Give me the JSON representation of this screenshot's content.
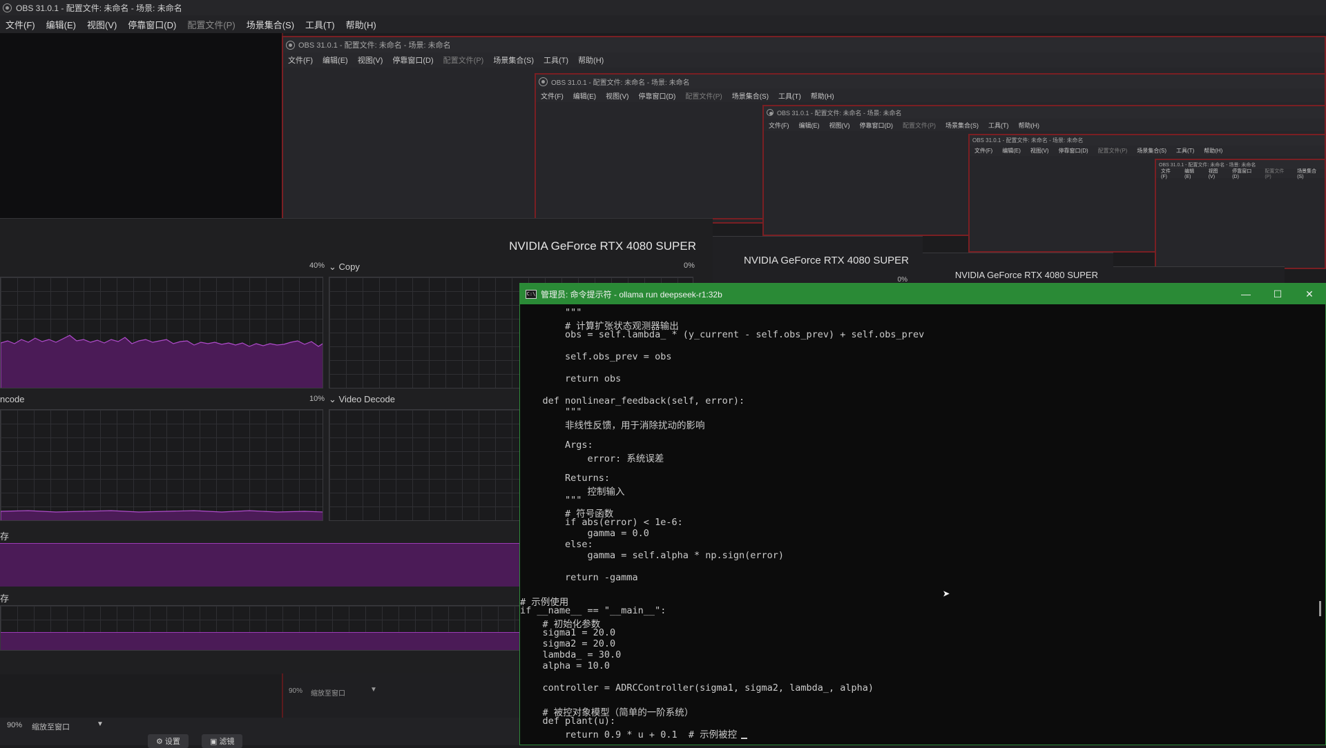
{
  "obs": {
    "title": "OBS 31.0.1 - 配置文件: 未命名 - 场景: 未命名",
    "menu": [
      "文件(F)",
      "编辑(E)",
      "视图(V)",
      "停靠窗口(D)",
      "配置文件(P)",
      "场景集合(S)",
      "工具(T)",
      "帮助(H)"
    ]
  },
  "gpu": {
    "name": "NVIDIA GeForce RTX 4080 SUPER",
    "copy_label": "Copy",
    "copy_pct": "0%",
    "left_top_pct": "40%",
    "encode_label": "ncode",
    "decode_label": "Video Decode",
    "left_mid_pct": "10%",
    "mem1_label": "存",
    "mem2_label": "存"
  },
  "terminal": {
    "title": "管理员: 命令提示符 - ollama  run deepseek-r1:32b",
    "icon_text": "C:\\",
    "lines": [
      "        \"\"\"",
      "        # 计算扩张状态观测器输出",
      "        obs = self.lambda_ * (y_current - self.obs_prev) + self.obs_prev",
      "",
      "        self.obs_prev = obs",
      "",
      "        return obs",
      "",
      "    def nonlinear_feedback(self, error):",
      "        \"\"\"",
      "        非线性反馈，用于消除扰动的影响",
      "",
      "        Args:",
      "            error: 系统误差",
      "",
      "        Returns:",
      "            控制输入",
      "        \"\"\"",
      "        # 符号函数",
      "        if abs(error) < 1e-6:",
      "            gamma = 0.0",
      "        else:",
      "            gamma = self.alpha * np.sign(error)",
      "",
      "        return -gamma",
      "",
      "# 示例使用",
      "if __name__ == \"__main__\":",
      "    # 初始化参数",
      "    sigma1 = 20.0",
      "    sigma2 = 20.0",
      "    lambda_ = 30.0",
      "    alpha = 10.0",
      "",
      "    controller = ADRCController(sigma1, sigma2, lambda_, alpha)",
      "",
      "    # 被控对象模型（简单的一阶系统）",
      "    def plant(u):",
      "        return 0.9 * u + 0.1  # 示例被控"
    ]
  },
  "bottom": {
    "zoom": "90%",
    "fit_label": "缩放至窗口",
    "nested_zoom": "90%",
    "nested_fit": "缩放至窗口",
    "btn1": "设置",
    "btn2": "滤镜"
  },
  "colors": {
    "terminal_titlebar": "#2a8a36",
    "capture_border": "#7a1f23",
    "graph_fill": "#4b1b57",
    "graph_line": "#9c3cb6"
  }
}
